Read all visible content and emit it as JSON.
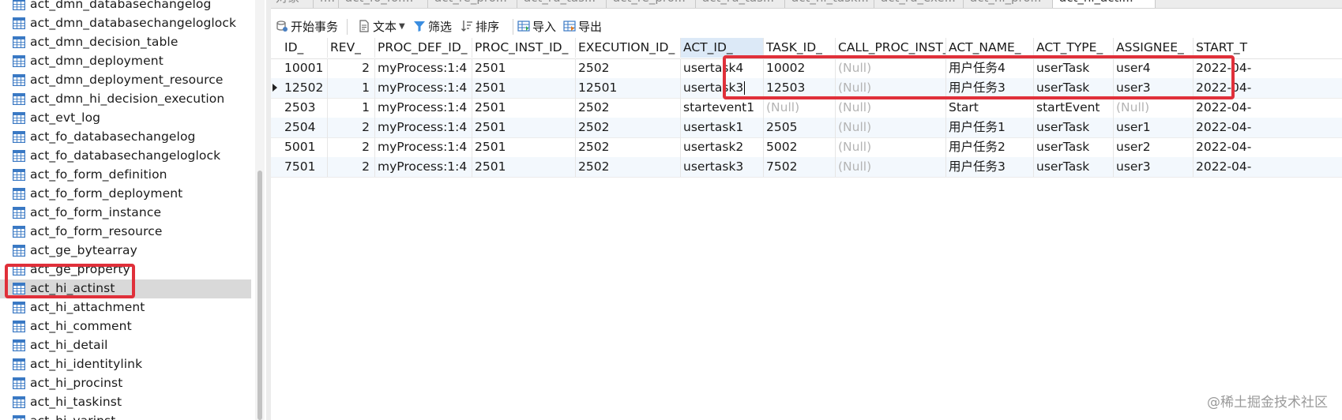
{
  "sidebar": {
    "items": [
      {
        "label": "act_dmn_databasechangelog"
      },
      {
        "label": "act_dmn_databasechangeloglock"
      },
      {
        "label": "act_dmn_decision_table"
      },
      {
        "label": "act_dmn_deployment"
      },
      {
        "label": "act_dmn_deployment_resource"
      },
      {
        "label": "act_dmn_hi_decision_execution"
      },
      {
        "label": "act_evt_log"
      },
      {
        "label": "act_fo_databasechangelog"
      },
      {
        "label": "act_fo_databasechangeloglock"
      },
      {
        "label": "act_fo_form_definition"
      },
      {
        "label": "act_fo_form_deployment"
      },
      {
        "label": "act_fo_form_instance"
      },
      {
        "label": "act_fo_form_resource"
      },
      {
        "label": "act_ge_bytearray"
      },
      {
        "label": "act_ge_property"
      },
      {
        "label": "act_hi_actinst",
        "selected": true
      },
      {
        "label": "act_hi_attachment"
      },
      {
        "label": "act_hi_comment"
      },
      {
        "label": "act_hi_detail"
      },
      {
        "label": "act_hi_identitylink"
      },
      {
        "label": "act_hi_procinst"
      },
      {
        "label": "act_hi_taskinst"
      },
      {
        "label": "act_hi_varinst"
      }
    ]
  },
  "tabs": [
    {
      "label": "对象"
    },
    {
      "label": "r..."
    },
    {
      "label": "act_fo_for..."
    },
    {
      "label": "act_re_pro..."
    },
    {
      "label": "act_ru_tas..."
    },
    {
      "label": "act_re_pro..."
    },
    {
      "label": "act_ru_tas..."
    },
    {
      "label": "act_hi_task..."
    },
    {
      "label": "act_ru_exe..."
    },
    {
      "label": "act_hi_pro..."
    },
    {
      "label": "act_hi_acti..."
    }
  ],
  "toolbar": {
    "begin_transaction": "开始事务",
    "text": "文本",
    "filter": "筛选",
    "sort": "排序",
    "import": "导入",
    "export": "导出"
  },
  "grid": {
    "columns": [
      "ID_",
      "REV_",
      "PROC_DEF_ID_",
      "PROC_INST_ID_",
      "EXECUTION_ID_",
      "ACT_ID_",
      "TASK_ID_",
      "CALL_PROC_INST_ID_",
      "ACT_NAME_",
      "ACT_TYPE_",
      "ASSIGNEE_",
      "START_T"
    ],
    "rows": [
      [
        "10001",
        "2",
        "myProcess:1:4",
        "2501",
        "2502",
        "usertask4",
        "10002",
        "(Null)",
        "用户任务4",
        "userTask",
        "user4",
        "2022-04-"
      ],
      [
        "12502",
        "1",
        "myProcess:1:4",
        "2501",
        "12501",
        "usertask3",
        "12503",
        "(Null)",
        "用户任务3",
        "userTask",
        "user3",
        "2022-04-"
      ],
      [
        "2503",
        "1",
        "myProcess:1:4",
        "2501",
        "2502",
        "startevent1",
        "(Null)",
        "(Null)",
        "Start",
        "startEvent",
        "(Null)",
        "2022-04-"
      ],
      [
        "2504",
        "2",
        "myProcess:1:4",
        "2501",
        "2502",
        "usertask1",
        "2505",
        "(Null)",
        "用户任务1",
        "userTask",
        "user1",
        "2022-04-"
      ],
      [
        "5001",
        "2",
        "myProcess:1:4",
        "2501",
        "2502",
        "usertask2",
        "5002",
        "(Null)",
        "用户任务2",
        "userTask",
        "user2",
        "2022-04-"
      ],
      [
        "7501",
        "2",
        "myProcess:1:4",
        "2501",
        "2502",
        "usertask3",
        "7502",
        "(Null)",
        "用户任务3",
        "userTask",
        "user3",
        "2022-04-"
      ]
    ]
  },
  "watermark": "@稀土掘金技术社区",
  "colors": {
    "highlight": "#e0303a",
    "sorted_header": "#dce9f7",
    "alt_row": "#f3f8fd",
    "null_text": "#b4b4b4"
  }
}
